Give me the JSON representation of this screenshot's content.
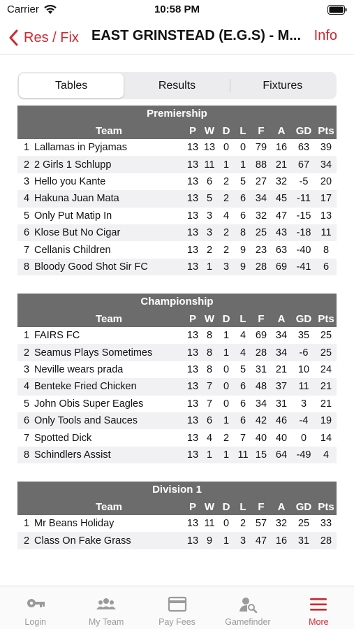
{
  "status_bar": {
    "carrier": "Carrier",
    "time": "10:58 PM"
  },
  "nav": {
    "back_label": "Res / Fix",
    "title": "EAST GRINSTEAD (E.G.S) - M...",
    "info_label": "Info"
  },
  "segments": [
    "Tables",
    "Results",
    "Fixtures"
  ],
  "active_segment": "Tables",
  "columns": {
    "team": "Team",
    "p": "P",
    "w": "W",
    "d": "D",
    "l": "L",
    "f": "F",
    "a": "A",
    "gd": "GD",
    "pts": "Pts"
  },
  "leagues": [
    {
      "name": "Premiership",
      "rows": [
        {
          "pos": "1",
          "team": "Lallamas in Pyjamas",
          "p": "13",
          "w": "13",
          "d": "0",
          "l": "0",
          "f": "79",
          "a": "16",
          "gd": "63",
          "pts": "39"
        },
        {
          "pos": "2",
          "team": "2 Girls 1 Schlupp",
          "p": "13",
          "w": "11",
          "d": "1",
          "l": "1",
          "f": "88",
          "a": "21",
          "gd": "67",
          "pts": "34"
        },
        {
          "pos": "3",
          "team": "Hello you Kante",
          "p": "13",
          "w": "6",
          "d": "2",
          "l": "5",
          "f": "27",
          "a": "32",
          "gd": "-5",
          "pts": "20"
        },
        {
          "pos": "4",
          "team": "Hakuna Juan Mata",
          "p": "13",
          "w": "5",
          "d": "2",
          "l": "6",
          "f": "34",
          "a": "45",
          "gd": "-11",
          "pts": "17"
        },
        {
          "pos": "5",
          "team": "Only Put Matip In",
          "p": "13",
          "w": "3",
          "d": "4",
          "l": "6",
          "f": "32",
          "a": "47",
          "gd": "-15",
          "pts": "13"
        },
        {
          "pos": "6",
          "team": "Klose But No Cigar",
          "p": "13",
          "w": "3",
          "d": "2",
          "l": "8",
          "f": "25",
          "a": "43",
          "gd": "-18",
          "pts": "11"
        },
        {
          "pos": "7",
          "team": "Cellanis Children",
          "p": "13",
          "w": "2",
          "d": "2",
          "l": "9",
          "f": "23",
          "a": "63",
          "gd": "-40",
          "pts": "8"
        },
        {
          "pos": "8",
          "team": "Bloody Good Shot Sir FC",
          "p": "13",
          "w": "1",
          "d": "3",
          "l": "9",
          "f": "28",
          "a": "69",
          "gd": "-41",
          "pts": "6"
        }
      ]
    },
    {
      "name": "Championship",
      "rows": [
        {
          "pos": "1",
          "team": "FAIRS FC",
          "p": "13",
          "w": "8",
          "d": "1",
          "l": "4",
          "f": "69",
          "a": "34",
          "gd": "35",
          "pts": "25"
        },
        {
          "pos": "2",
          "team": "Seamus Plays Sometimes",
          "p": "13",
          "w": "8",
          "d": "1",
          "l": "4",
          "f": "28",
          "a": "34",
          "gd": "-6",
          "pts": "25"
        },
        {
          "pos": "3",
          "team": "Neville wears prada",
          "p": "13",
          "w": "8",
          "d": "0",
          "l": "5",
          "f": "31",
          "a": "21",
          "gd": "10",
          "pts": "24"
        },
        {
          "pos": "4",
          "team": "Benteke Fried Chicken",
          "p": "13",
          "w": "7",
          "d": "0",
          "l": "6",
          "f": "48",
          "a": "37",
          "gd": "11",
          "pts": "21"
        },
        {
          "pos": "5",
          "team": "John Obis Super Eagles",
          "p": "13",
          "w": "7",
          "d": "0",
          "l": "6",
          "f": "34",
          "a": "31",
          "gd": "3",
          "pts": "21"
        },
        {
          "pos": "6",
          "team": "Only Tools and Sauces",
          "p": "13",
          "w": "6",
          "d": "1",
          "l": "6",
          "f": "42",
          "a": "46",
          "gd": "-4",
          "pts": "19"
        },
        {
          "pos": "7",
          "team": "Spotted Dick",
          "p": "13",
          "w": "4",
          "d": "2",
          "l": "7",
          "f": "40",
          "a": "40",
          "gd": "0",
          "pts": "14"
        },
        {
          "pos": "8",
          "team": "Schindlers Assist",
          "p": "13",
          "w": "1",
          "d": "1",
          "l": "11",
          "f": "15",
          "a": "64",
          "gd": "-49",
          "pts": "4"
        }
      ]
    },
    {
      "name": "Division 1",
      "rows": [
        {
          "pos": "1",
          "team": "Mr Beans Holiday",
          "p": "13",
          "w": "11",
          "d": "0",
          "l": "2",
          "f": "57",
          "a": "32",
          "gd": "25",
          "pts": "33"
        },
        {
          "pos": "2",
          "team": "Class On Fake Grass",
          "p": "13",
          "w": "9",
          "d": "1",
          "l": "3",
          "f": "47",
          "a": "16",
          "gd": "31",
          "pts": "28"
        }
      ]
    }
  ],
  "tabs": [
    {
      "label": "Login",
      "icon": "key-icon"
    },
    {
      "label": "My Team",
      "icon": "team-icon"
    },
    {
      "label": "Pay Fees",
      "icon": "card-icon"
    },
    {
      "label": "Gamefinder",
      "icon": "person-search-icon"
    },
    {
      "label": "More",
      "icon": "menu-icon"
    }
  ],
  "active_tab": "More",
  "colors": {
    "accent": "#d0282e",
    "header_bg": "#6c6c6c",
    "alt_row": "#f1f1f4",
    "tab_inactive": "#9a9a9a"
  }
}
